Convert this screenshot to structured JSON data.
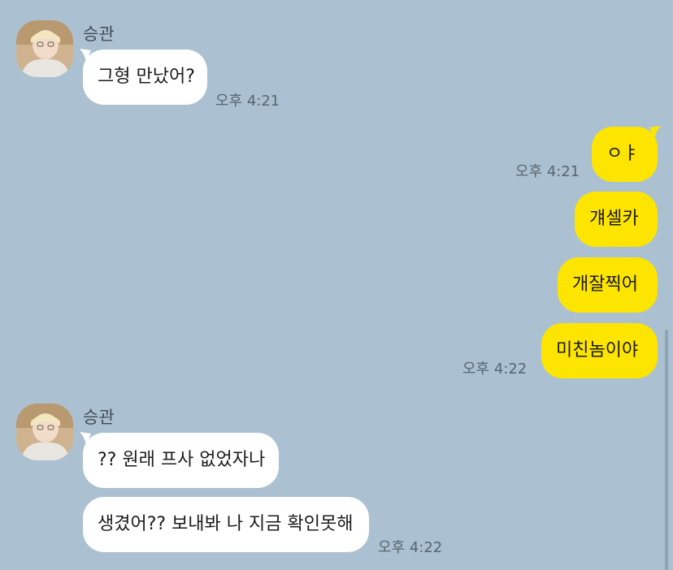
{
  "messages": {
    "group1": {
      "sender": "승관",
      "bubble1": "그형 만났어?",
      "time": "오후 4:21"
    },
    "group2": {
      "bubble1": "ㅇㅑ",
      "time1": "오후 4:21",
      "bubble2": "걔셀카",
      "bubble3": "개잘찍어",
      "bubble4": "미친놈이야",
      "time4": "오후 4:22"
    },
    "group3": {
      "sender": "승관",
      "bubble1": "?? 원래 프사 없었자나",
      "bubble2": "생겼어?? 보내봐 나 지금 확인못해",
      "time": "오후 4:22"
    }
  },
  "colors": {
    "background": "#abc1d1",
    "incoming_bubble": "#ffffff",
    "outgoing_bubble": "#fee500"
  },
  "icons": {
    "avatar": "profile-photo"
  }
}
